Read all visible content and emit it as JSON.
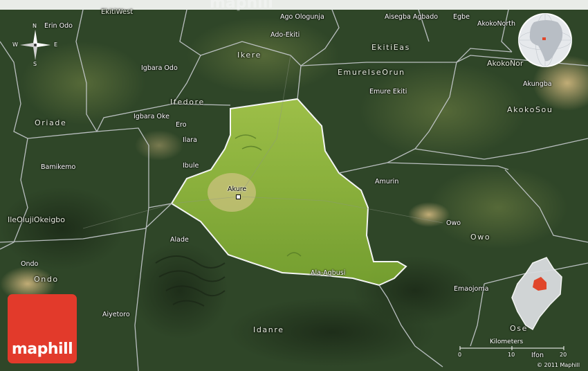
{
  "map": {
    "watermark": "maphill",
    "brand_text": "maphill",
    "copyright": "© 2011 Maphill",
    "colors": {
      "satellite_base": "#2f4628",
      "highlight_fill": "#8fbf3a",
      "border_line": "#c8ccd0",
      "highlight_border": "#ffffff",
      "brand": "#e23a2b",
      "inset_marker": "#e0462a"
    },
    "compass": {
      "icon": "compass-rose-icon",
      "north": "N",
      "south": "S",
      "east": "E",
      "west": "W"
    },
    "globe_icon": "globe-inset-icon",
    "scale_bar": {
      "title": "Kilometers",
      "ticks": [
        "0",
        "10",
        "20"
      ]
    },
    "regions": [
      {
        "name": "Ekiti West",
        "text": "EkitiWest"
      },
      {
        "name": "Ikere",
        "text": "Ikere"
      },
      {
        "name": "Ekiti East",
        "text": "EkitiEas"
      },
      {
        "name": "Emure Ise Orun",
        "text": "EmureIseOrun"
      },
      {
        "name": "Ifedore",
        "text": "Ifedore"
      },
      {
        "name": "Oriade",
        "text": "Oriade"
      },
      {
        "name": "Akoko South",
        "text": "AkokoSou"
      },
      {
        "name": "Owo",
        "text": "Owo"
      },
      {
        "name": "Ondo",
        "text": "Ondo"
      },
      {
        "name": "Idanre",
        "text": "Idanre"
      },
      {
        "name": "Ose",
        "text": "Ose"
      },
      {
        "name": "Ile Oluji Okeigbo",
        "text": "IleOlujiOkeigbo"
      },
      {
        "name": "Akoko North",
        "text": "AkokoNor"
      }
    ],
    "towns": [
      "Erin Odo",
      "Ago Ologunja",
      "Aisegba Agbado",
      "Egbe",
      "Ado-Ekiti",
      "AkokoNorth",
      "Igbara Odo",
      "Emure Ekiti",
      "Akungba",
      "Igbara Oke",
      "Ero",
      "Ilara",
      "Bamikemo",
      "Ibule",
      "Akure",
      "Amurin",
      "Owo",
      "Alade",
      "Ala-Agbusi",
      "Ondo",
      "Aiyetoro",
      "Emaojoma",
      "Ifon"
    ]
  }
}
